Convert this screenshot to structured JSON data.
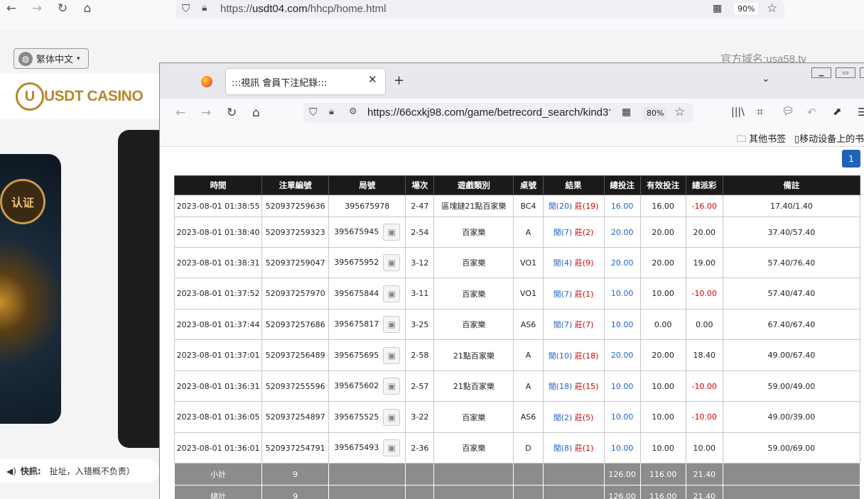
{
  "main_browser": {
    "url_domain": "usdt04.com",
    "url_rest": "/hhcp/home.html",
    "url_scheme": "https://",
    "zoom": "90%"
  },
  "site": {
    "language": "繁体中文",
    "logo": "USDT CASINO",
    "domain_label": "官方域名:usa58.tv",
    "badge": "认证",
    "news_label": "快訊:",
    "news_text": "扯址，入错概不负责）"
  },
  "popup": {
    "tab_title": ":::視訊 會員下注紀錄:::",
    "url": "https://66cxkj98.com/game/betrecord_search/kind3?",
    "zoom": "80%",
    "bookmark_other": "其他书签",
    "bookmark_mobile": "移动设备上的书",
    "page": "1"
  },
  "table": {
    "headers": [
      "時間",
      "注單編號",
      "局號",
      "場次",
      "遊戲類別",
      "桌號",
      "結果",
      "總投注",
      "有效投注",
      "總派彩",
      "備註"
    ],
    "rows": [
      {
        "time": "2023-08-01 01:38:55",
        "order": "520937259636",
        "round": "395675978",
        "icon": false,
        "session": "2-47",
        "game": "區塊鏈21點百家樂",
        "table": "BC4",
        "p": "閒(20)",
        "b": "莊(19)",
        "bet": "16.00",
        "valid": "16.00",
        "payout": "-16.00",
        "neg": true,
        "note": "17.40/1.40"
      },
      {
        "time": "2023-08-01 01:38:40",
        "order": "520937259323",
        "round": "395675945",
        "icon": true,
        "session": "2-54",
        "game": "百家樂",
        "table": "A",
        "p": "閒(7)",
        "b": "莊(2)",
        "bet": "20.00",
        "valid": "20.00",
        "payout": "20.00",
        "neg": false,
        "note": "37.40/57.40"
      },
      {
        "time": "2023-08-01 01:38:31",
        "order": "520937259047",
        "round": "395675952",
        "icon": true,
        "session": "3-12",
        "game": "百家樂",
        "table": "VO1",
        "p": "閒(4)",
        "b": "莊(9)",
        "bet": "20.00",
        "valid": "20.00",
        "payout": "19.00",
        "neg": false,
        "note": "57.40/76.40"
      },
      {
        "time": "2023-08-01 01:37:52",
        "order": "520937257970",
        "round": "395675844",
        "icon": true,
        "session": "3-11",
        "game": "百家樂",
        "table": "VO1",
        "p": "閒(7)",
        "b": "莊(1)",
        "bet": "10.00",
        "valid": "10.00",
        "payout": "-10.00",
        "neg": true,
        "note": "57.40/47.40"
      },
      {
        "time": "2023-08-01 01:37:44",
        "order": "520937257686",
        "round": "395675817",
        "icon": true,
        "session": "3-25",
        "game": "百家樂",
        "table": "AS6",
        "p": "閒(7)",
        "b": "莊(7)",
        "bet": "10.00",
        "valid": "0.00",
        "payout": "0.00",
        "neg": false,
        "note": "67.40/67.40"
      },
      {
        "time": "2023-08-01 01:37:01",
        "order": "520937256489",
        "round": "395675695",
        "icon": true,
        "session": "2-58",
        "game": "21點百家樂",
        "table": "A",
        "p": "閒(10)",
        "b": "莊(18)",
        "bet": "20.00",
        "valid": "20.00",
        "payout": "18.40",
        "neg": false,
        "note": "49.00/67.40"
      },
      {
        "time": "2023-08-01 01:36:31",
        "order": "520937255596",
        "round": "395675602",
        "icon": true,
        "session": "2-57",
        "game": "21點百家樂",
        "table": "A",
        "p": "閒(18)",
        "b": "莊(15)",
        "bet": "10.00",
        "valid": "10.00",
        "payout": "-10.00",
        "neg": true,
        "note": "59.00/49.00"
      },
      {
        "time": "2023-08-01 01:36:05",
        "order": "520937254897",
        "round": "395675525",
        "icon": true,
        "session": "3-22",
        "game": "百家樂",
        "table": "AS6",
        "p": "閒(2)",
        "b": "莊(5)",
        "bet": "10.00",
        "valid": "10.00",
        "payout": "-10.00",
        "neg": true,
        "note": "49.00/39.00"
      },
      {
        "time": "2023-08-01 01:36:01",
        "order": "520937254791",
        "round": "395675493",
        "icon": true,
        "session": "2-36",
        "game": "百家樂",
        "table": "D",
        "p": "閒(8)",
        "b": "莊(1)",
        "bet": "10.00",
        "valid": "10.00",
        "payout": "10.00",
        "neg": false,
        "note": "59.00/69.00"
      }
    ],
    "subtotal": {
      "label": "小計",
      "count": "9",
      "bet": "126.00",
      "valid": "116.00",
      "payout": "21.40"
    },
    "total": {
      "label": "總計",
      "count": "9",
      "bet": "126.00",
      "valid": "116.00",
      "payout": "21.40"
    }
  }
}
